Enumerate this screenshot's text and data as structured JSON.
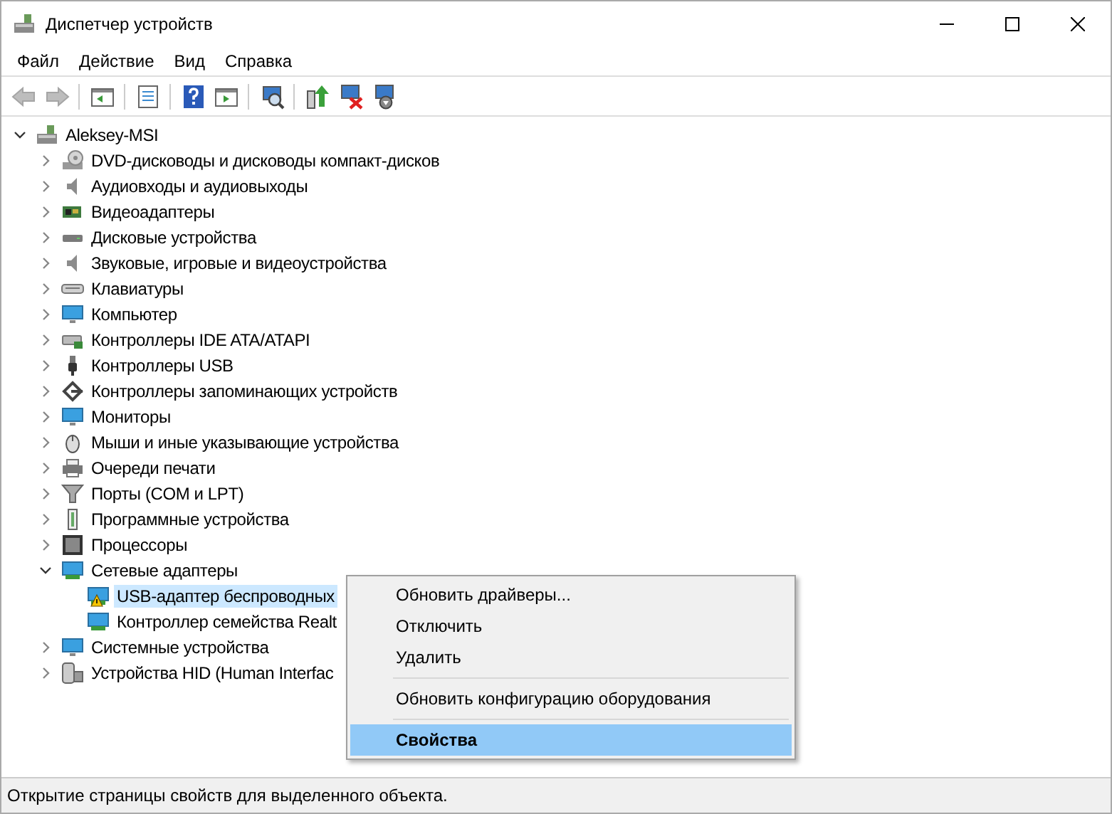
{
  "window": {
    "title": "Диспетчер устройств"
  },
  "menu": [
    "Файл",
    "Действие",
    "Вид",
    "Справка"
  ],
  "toolbar": [
    {
      "kind": "back",
      "disabled": true
    },
    {
      "kind": "forward",
      "disabled": true
    },
    {
      "kind": "sep"
    },
    {
      "kind": "console",
      "disabled": false
    },
    {
      "kind": "sep"
    },
    {
      "kind": "properties",
      "disabled": false
    },
    {
      "kind": "sep"
    },
    {
      "kind": "help",
      "disabled": false
    },
    {
      "kind": "action",
      "disabled": false
    },
    {
      "kind": "sep"
    },
    {
      "kind": "scan",
      "disabled": false
    },
    {
      "kind": "sep"
    },
    {
      "kind": "update",
      "disabled": false
    },
    {
      "kind": "remove",
      "disabled": false
    },
    {
      "kind": "install",
      "disabled": false
    }
  ],
  "tree": {
    "label": "Aleksey-MSI",
    "expanded": true,
    "selected": false,
    "children": [
      {
        "label": "DVD-дисководы и дисководы компакт-дисков",
        "expanded": false,
        "selected": false
      },
      {
        "label": "Аудиовходы и аудиовыходы",
        "expanded": false,
        "selected": false
      },
      {
        "label": "Видеоадаптеры",
        "expanded": false,
        "selected": false
      },
      {
        "label": "Дисковые устройства",
        "expanded": false,
        "selected": false
      },
      {
        "label": "Звуковые, игровые и видеоустройства",
        "expanded": false,
        "selected": false
      },
      {
        "label": "Клавиатуры",
        "expanded": false,
        "selected": false
      },
      {
        "label": "Компьютер",
        "expanded": false,
        "selected": false
      },
      {
        "label": "Контроллеры IDE ATA/ATAPI",
        "expanded": false,
        "selected": false
      },
      {
        "label": "Контроллеры USB",
        "expanded": false,
        "selected": false
      },
      {
        "label": "Контроллеры запоминающих устройств",
        "expanded": false,
        "selected": false
      },
      {
        "label": "Мониторы",
        "expanded": false,
        "selected": false
      },
      {
        "label": "Мыши и иные указывающие устройства",
        "expanded": false,
        "selected": false
      },
      {
        "label": "Очереди печати",
        "expanded": false,
        "selected": false
      },
      {
        "label": "Порты (COM и LPT)",
        "expanded": false,
        "selected": false
      },
      {
        "label": "Программные устройства",
        "expanded": false,
        "selected": false
      },
      {
        "label": "Процессоры",
        "expanded": false,
        "selected": false
      },
      {
        "label": "Сетевые адаптеры",
        "expanded": true,
        "selected": false,
        "children": [
          {
            "label": "USB-адаптер беспроводных",
            "selected": true,
            "warning": true
          },
          {
            "label": "Контроллер семейства Realt",
            "selected": false,
            "warning": false
          }
        ]
      },
      {
        "label": "Системные устройства",
        "expanded": false,
        "selected": false
      },
      {
        "label": "Устройства HID (Human Interfac",
        "expanded": false,
        "selected": false
      }
    ]
  },
  "context_menu": [
    {
      "kind": "item",
      "label": "Обновить драйверы...",
      "selected": false,
      "default": false
    },
    {
      "kind": "item",
      "label": "Отключить",
      "selected": false,
      "default": false
    },
    {
      "kind": "item",
      "label": "Удалить",
      "selected": false,
      "default": false
    },
    {
      "kind": "separator"
    },
    {
      "kind": "item",
      "label": "Обновить конфигурацию оборудования",
      "selected": false,
      "default": false
    },
    {
      "kind": "separator"
    },
    {
      "kind": "item",
      "label": "Свойства",
      "selected": true,
      "default": true
    }
  ],
  "status_bar": "Открытие страницы свойств для выделенного объекта."
}
